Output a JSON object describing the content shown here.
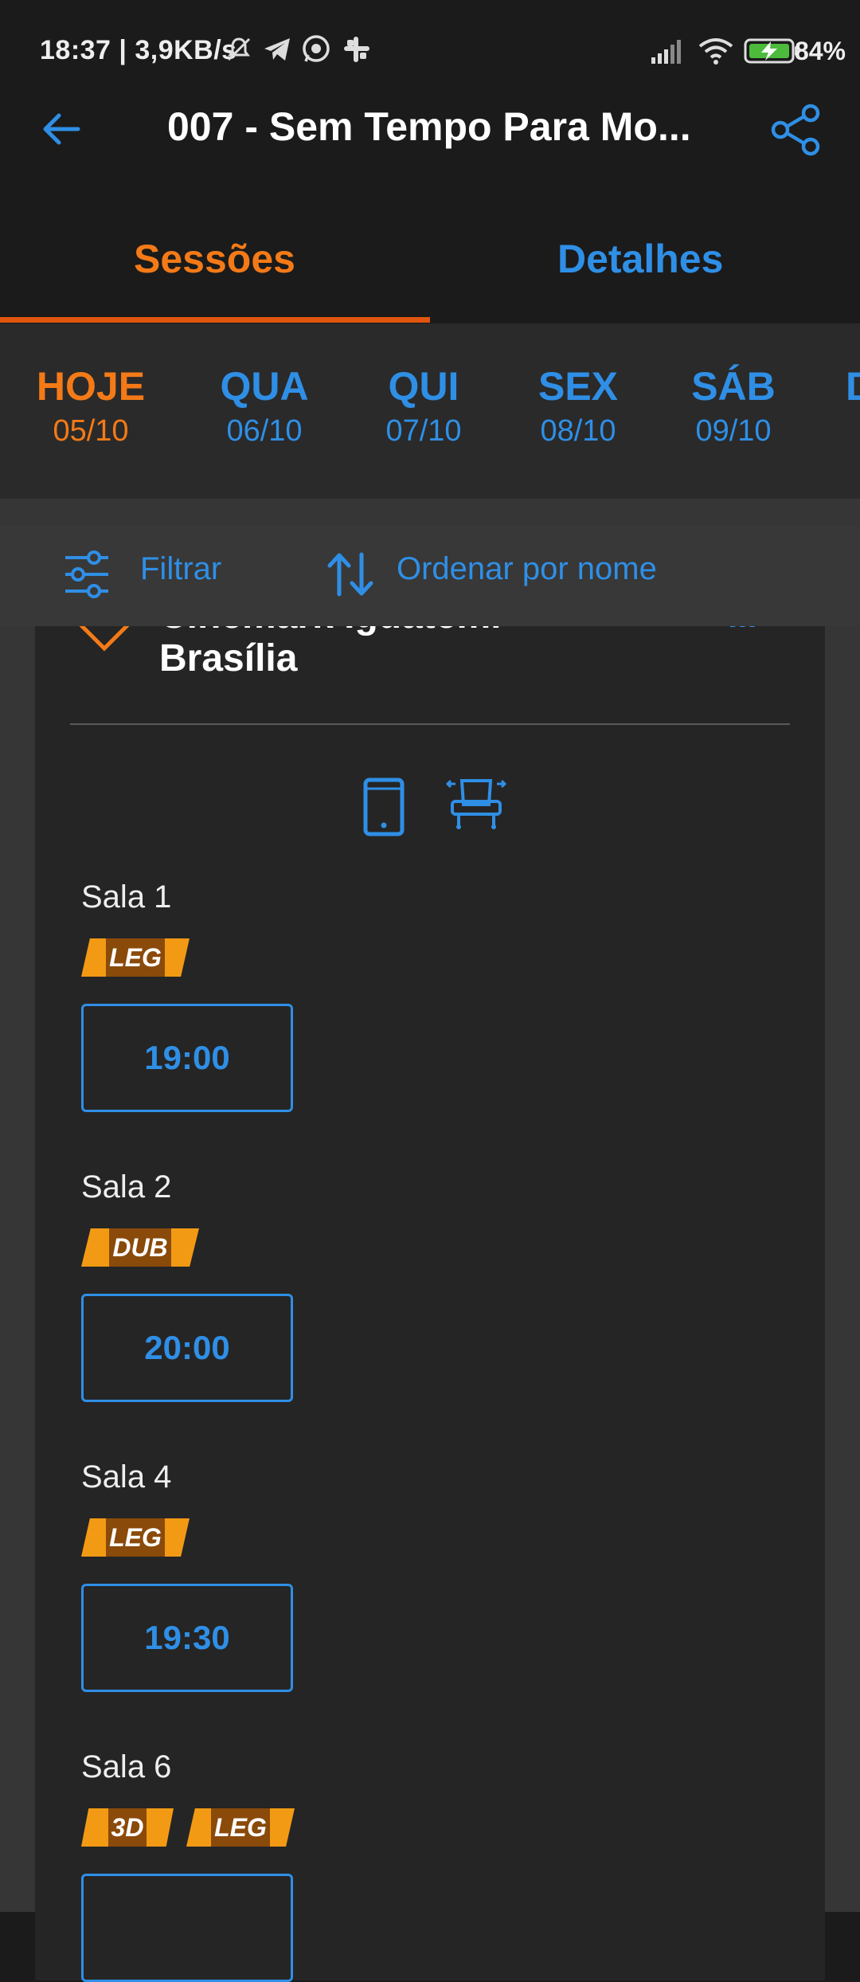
{
  "status_bar": {
    "time": "18:37 | 3,9KB/s",
    "battery": "84%"
  },
  "appbar": {
    "title": "007 - Sem Tempo Para Mo...",
    "back_icon": "arrow-left-icon",
    "share_icon": "share-icon"
  },
  "tabs": [
    {
      "label": "Sessões",
      "active": true
    },
    {
      "label": "Detalhes",
      "active": false
    }
  ],
  "dates": [
    {
      "day": "HOJE",
      "date": "05/10",
      "selected": true
    },
    {
      "day": "QUA",
      "date": "06/10",
      "selected": false
    },
    {
      "day": "QUI",
      "date": "07/10",
      "selected": false
    },
    {
      "day": "SEX",
      "date": "08/10",
      "selected": false
    },
    {
      "day": "SÁB",
      "date": "09/10",
      "selected": false
    },
    {
      "day": "D",
      "date": "",
      "selected": false
    }
  ],
  "toolbar": {
    "filter_label": "Filtrar",
    "sort_label": "Ordenar por nome"
  },
  "cinema": {
    "name_line1": "Cinemark Iguatemi",
    "name_line2": "Brasília",
    "more_label": "..."
  },
  "sessions": [
    {
      "room": "Sala 1",
      "badges": [
        "LEG"
      ],
      "time": "19:00"
    },
    {
      "room": "Sala 2",
      "badges": [
        "DUB"
      ],
      "time": "20:00"
    },
    {
      "room": "Sala 4",
      "badges": [
        "LEG"
      ],
      "time": "19:30"
    },
    {
      "room": "Sala 6",
      "badges": [
        "3D",
        "LEG"
      ],
      "time": ""
    }
  ],
  "colors": {
    "accent_orange": "#f47a17",
    "accent_blue": "#2f8fe6",
    "badge_orange": "#f39a14"
  }
}
